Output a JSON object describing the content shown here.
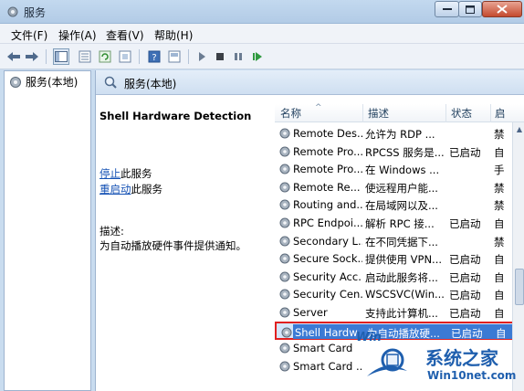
{
  "window": {
    "title": "服务"
  },
  "menu": [
    "文件(F)",
    "操作(A)",
    "查看(V)",
    "帮助(H)"
  ],
  "tree": {
    "root_label": "服务(本地)"
  },
  "panel": {
    "header": "服务(本地)"
  },
  "detail": {
    "service_title": "Shell Hardware Detection",
    "stop_link": "停止",
    "stop_suffix": "此服务",
    "restart_link": "重启动",
    "restart_suffix": "此服务",
    "desc_label": "描述:",
    "desc_text": "为自动播放硬件事件提供通知。"
  },
  "columns": {
    "name": "名称",
    "desc": "描述",
    "status": "状态",
    "start": "启"
  },
  "rows": [
    {
      "name": "Remote Des...",
      "desc": "允许为 RDP ...",
      "status": "",
      "start": "禁"
    },
    {
      "name": "Remote Pro...",
      "desc": "RPCSS 服务是...",
      "status": "已启动",
      "start": "自"
    },
    {
      "name": "Remote Pro...",
      "desc": "在 Windows ...",
      "status": "",
      "start": "手"
    },
    {
      "name": "Remote Re...",
      "desc": "使远程用户能...",
      "status": "",
      "start": "禁"
    },
    {
      "name": "Routing and...",
      "desc": "在局域网以及...",
      "status": "",
      "start": "禁"
    },
    {
      "name": "RPC Endpoi...",
      "desc": "解析 RPC 接...",
      "status": "已启动",
      "start": "自"
    },
    {
      "name": "Secondary L...",
      "desc": "在不同凭据下...",
      "status": "",
      "start": "禁"
    },
    {
      "name": "Secure Sock...",
      "desc": "提供使用 VPN...",
      "status": "已启动",
      "start": "自"
    },
    {
      "name": "Security Acc...",
      "desc": "启动此服务将...",
      "status": "已启动",
      "start": "自"
    },
    {
      "name": "Security Cen...",
      "desc": "WSCSVC(Win...",
      "status": "已启动",
      "start": "自"
    },
    {
      "name": "Server",
      "desc": "支持此计算机...",
      "status": "已启动",
      "start": "自"
    },
    {
      "name": "Shell Hardw...",
      "desc": "为自动播放硬...",
      "status": "已启动",
      "start": "自"
    },
    {
      "name": "Smart Card",
      "desc": "",
      "status": "",
      "start": ""
    },
    {
      "name": "Smart Card ...",
      "desc": "",
      "status": "",
      "start": ""
    }
  ],
  "watermark": {
    "badge": "Win",
    "line1": "系统之家",
    "line2": "Win10net.com"
  },
  "colors": {
    "selection": "#3b7ad4",
    "highlight_border": "#e02020",
    "link": "#1451b4"
  }
}
